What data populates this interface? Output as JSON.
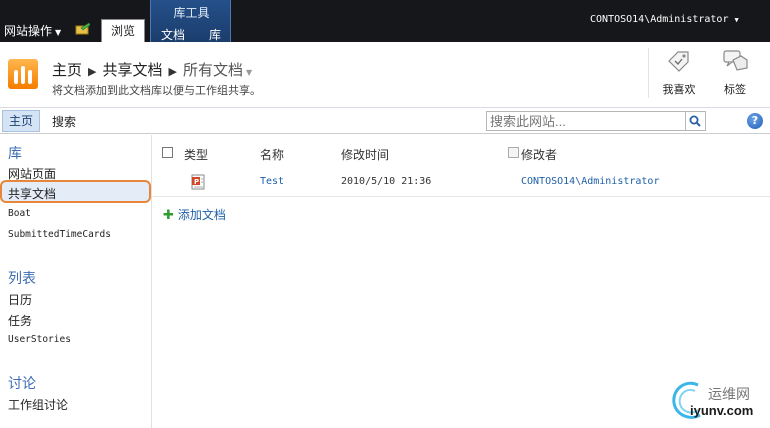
{
  "ribbon": {
    "site_actions": "网站操作",
    "browse_tab": "浏览",
    "tool_group_title": "库工具",
    "doc_tab": "文档",
    "lib_tab": "库",
    "user": "CONTOSO14\\Administrator"
  },
  "title_area": {
    "breadcrumb": [
      "主页",
      "共享文档",
      "所有文档"
    ],
    "description": "将文档添加到此文档库以便与工作组共享。",
    "like_label": "我喜欢",
    "tags_label": "标签"
  },
  "top_nav": {
    "home": "主页",
    "search": "搜索",
    "search_placeholder": "搜索此网站..."
  },
  "left_nav": {
    "libraries_heading": "库",
    "libraries": [
      "网站页面",
      "共享文档",
      "Boat",
      "SubmittedTimeCards"
    ],
    "lists_heading": "列表",
    "lists": [
      "日历",
      "任务",
      "UserStories"
    ],
    "discussions_heading": "讨论",
    "discussions": [
      "工作组讨论"
    ]
  },
  "list": {
    "columns": {
      "type": "类型",
      "name": "名称",
      "modified": "修改时间",
      "modified_by": "修改者"
    },
    "rows": [
      {
        "name": "Test",
        "modified": "2010/5/10 21:36",
        "modified_by": "CONTOSO14\\Administrator"
      }
    ],
    "add_document": "添加文档"
  },
  "watermark": {
    "site": "运维网",
    "url": "iyunv.com"
  },
  "colors": {
    "accent": "#1e5fa8",
    "highlight": "#e8873a",
    "ribbon": "#16171a"
  }
}
